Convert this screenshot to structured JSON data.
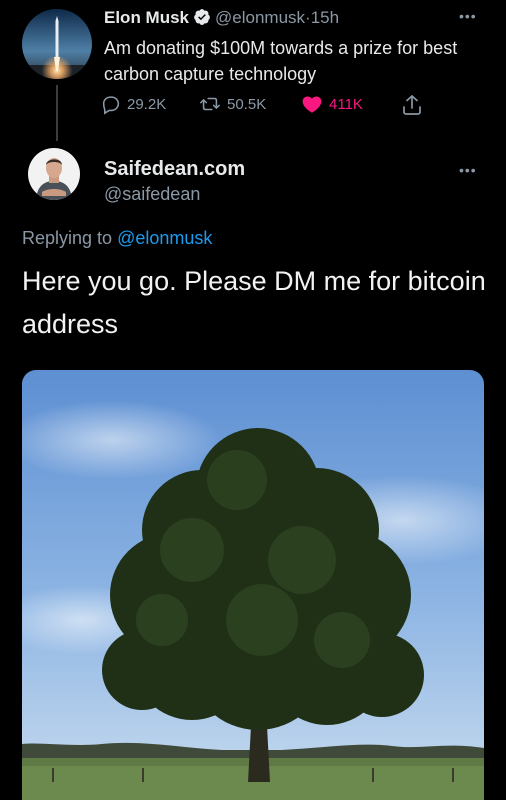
{
  "parent_tweet": {
    "author_name": "Elon Musk",
    "handle": "@elonmusk",
    "separator": "·",
    "time": "15h",
    "text": "Am donating $100M towards a prize for best carbon capture technology",
    "replies": "29.2K",
    "retweets": "50.5K",
    "likes": "411K",
    "like_color": "#f91880"
  },
  "reply_tweet": {
    "author_name": "Saifedean.com",
    "handle": "@saifedean",
    "replying_prefix": "Replying to",
    "replying_handle": "@elonmusk",
    "text": "Here you go. Please DM me for bitcoin address",
    "media_icon": "tree-photo"
  },
  "colors": {
    "background": "#000000",
    "primary_text": "#e7e9ea",
    "secondary_text": "#8b98a5",
    "link": "#1d9bf0",
    "verified": "#1d9bf0"
  }
}
